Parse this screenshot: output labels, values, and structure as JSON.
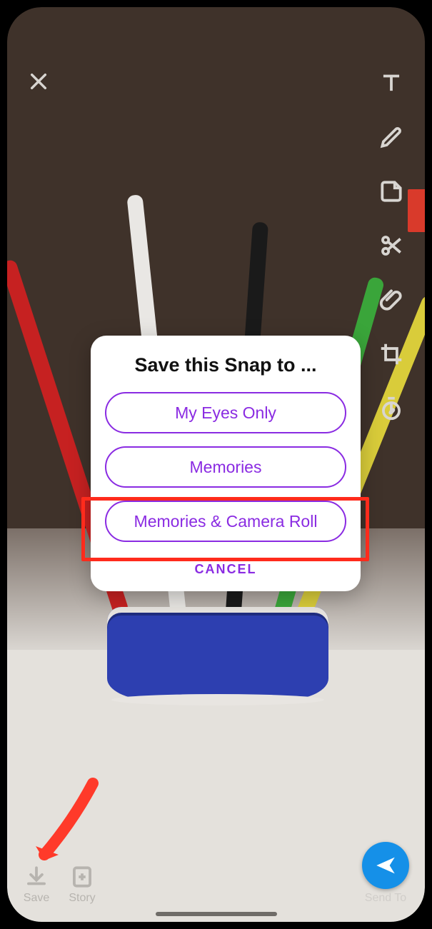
{
  "close_icon": "close",
  "tools": [
    "text",
    "draw",
    "sticker",
    "cut",
    "attach",
    "crop",
    "timer"
  ],
  "modal": {
    "title": "Save this Snap to ...",
    "options": [
      "My Eyes Only",
      "Memories",
      "Memories & Camera Roll"
    ],
    "cancel": "CANCEL"
  },
  "bottom": {
    "save": "Save",
    "story": "Story",
    "send": "Send To"
  }
}
